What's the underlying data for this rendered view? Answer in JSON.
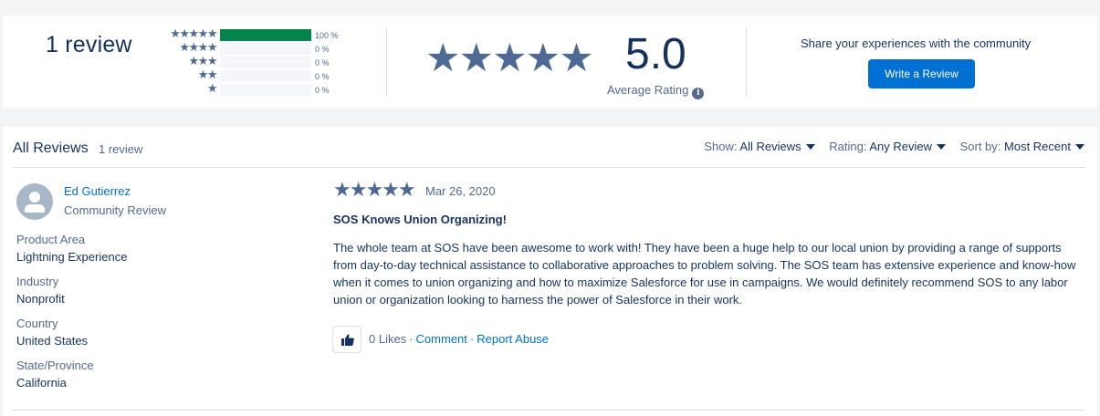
{
  "summary": {
    "review_count_label": "1 review",
    "distribution": [
      {
        "stars": "★★★★★",
        "fill": 1.0,
        "pct": "100 %"
      },
      {
        "stars": "★★★★",
        "fill": 0.0,
        "pct": "0 %"
      },
      {
        "stars": "★★★",
        "fill": 0.0,
        "pct": "0 %"
      },
      {
        "stars": "★★",
        "fill": 0.0,
        "pct": "0 %"
      },
      {
        "stars": "★",
        "fill": 0.0,
        "pct": "0 %"
      }
    ],
    "big_stars": "★★★★★",
    "average_rating": "5.0",
    "average_label": "Average Rating",
    "info_icon": "i",
    "share_text": "Share your experiences with the community",
    "write_button": "Write a Review"
  },
  "reviews": {
    "title": "All Reviews",
    "count": "1 review",
    "filters": {
      "show_label": "Show:",
      "show_value": "All Reviews",
      "rating_label": "Rating:",
      "rating_value": "Any Review",
      "sort_label": "Sort by:",
      "sort_value": "Most Recent"
    },
    "items": [
      {
        "reviewer": "Ed Gutierrez",
        "reviewer_type": "Community Review",
        "attributes": [
          {
            "label": "Product Area",
            "value": "Lightning Experience"
          },
          {
            "label": "Industry",
            "value": "Nonprofit"
          },
          {
            "label": "Country",
            "value": "United States"
          },
          {
            "label": "State/Province",
            "value": "California"
          }
        ],
        "stars": "★★★★★",
        "date": "Mar 26, 2020",
        "title": "SOS Knows Union Organizing!",
        "body": "The whole team at SOS have been awesome to work with! They have been a huge help to our local union by providing a range of supports from day-to-day technical assistance to collaborative approaches to problem solving. The SOS team has extensive experience and know-how when it comes to union organizing and how to maximize Salesforce for use in campaigns. We would definitely recommend SOS to any labor union or organization looking to harness the power of Salesforce in their work.",
        "likes": "0 Likes",
        "comment": "Comment",
        "report": "Report Abuse",
        "icons": {
          "avatar": "user-avatar-icon",
          "like": "thumbs-up-icon"
        }
      }
    ]
  },
  "colors": {
    "accent": "#0070d2",
    "bar_fill": "#04844b",
    "star": "#4f6a92",
    "text": "#16325c",
    "muted": "#54698d"
  }
}
